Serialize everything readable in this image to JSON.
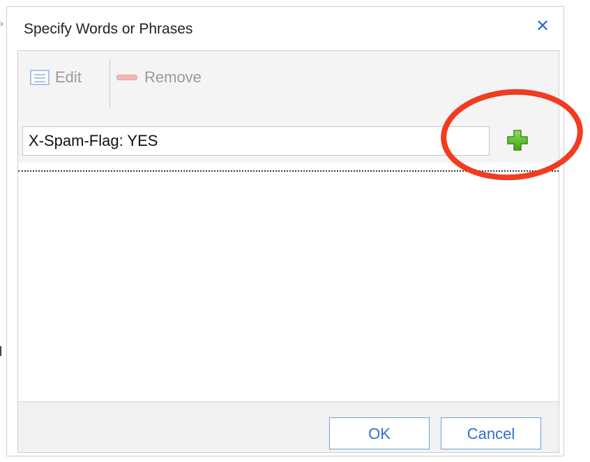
{
  "dialog": {
    "title": "Specify Words or Phrases",
    "close_icon": "close-icon"
  },
  "toolbar": {
    "edit_label": "Edit",
    "edit_icon": "list-edit-icon",
    "remove_label": "Remove",
    "remove_icon": "minus-icon"
  },
  "entry": {
    "value": "X-Spam-Flag: YES",
    "add_icon": "plus-icon"
  },
  "list": {
    "items": []
  },
  "footer": {
    "ok_label": "OK",
    "cancel_label": "Cancel"
  },
  "colors": {
    "accent": "#2f6fd0",
    "add_green": "#5cbf2a",
    "annotation_red": "#f23b1f",
    "remove_pink": "#f0b9b9"
  }
}
